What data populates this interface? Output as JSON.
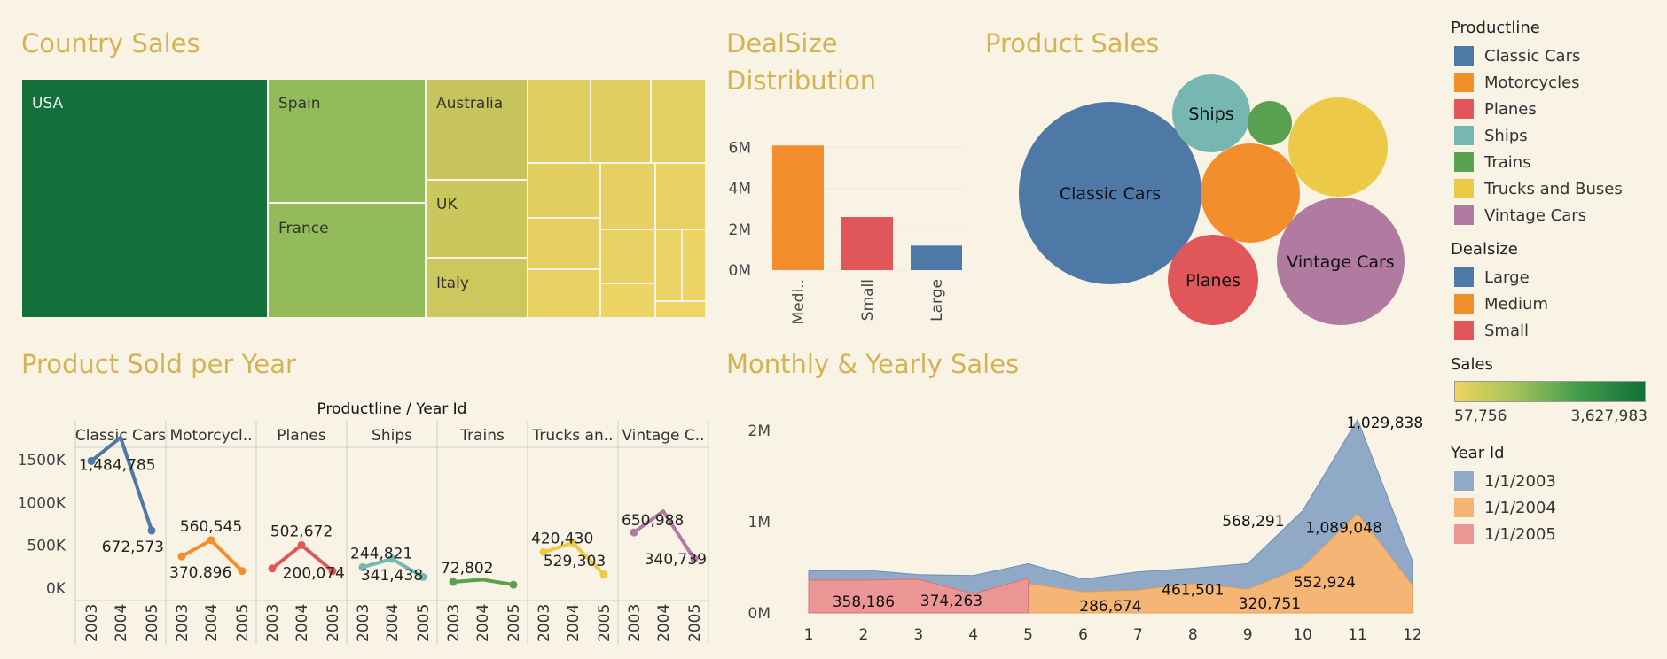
{
  "titles": {
    "country_sales": "Country Sales",
    "dealsize_line1": "DealSize",
    "dealsize_line2": "Distribution",
    "product_sales": "Product Sales",
    "product_sold_per_year": "Product Sold per Year",
    "monthly_yearly": "Monthly & Yearly Sales"
  },
  "legend": {
    "productline_title": "Productline",
    "productline_items": [
      {
        "label": "Classic Cars",
        "color": "#4e79a7"
      },
      {
        "label": "Motorcycles",
        "color": "#f28e2b"
      },
      {
        "label": "Planes",
        "color": "#e15759"
      },
      {
        "label": "Ships",
        "color": "#76b7b2"
      },
      {
        "label": "Trains",
        "color": "#59a14f"
      },
      {
        "label": "Trucks and Buses",
        "color": "#edc948"
      },
      {
        "label": "Vintage Cars",
        "color": "#b07aa1"
      }
    ],
    "dealsize_title": "Dealsize",
    "dealsize_items": [
      {
        "label": "Large",
        "color": "#4e79a7"
      },
      {
        "label": "Medium",
        "color": "#f28e2b"
      },
      {
        "label": "Small",
        "color": "#e15759"
      }
    ],
    "sales_title": "Sales",
    "sales_min": "57,756",
    "sales_max": "3,627,983",
    "year_title": "Year Id",
    "year_items": [
      {
        "label": "1/1/2003",
        "color": "#8fa9c7"
      },
      {
        "label": "1/1/2004",
        "color": "#f5b574"
      },
      {
        "label": "1/1/2005",
        "color": "#eb9595"
      }
    ]
  },
  "chart_data": [
    {
      "type": "treemap",
      "title": "Country Sales",
      "labels": [
        "USA",
        "Spain",
        "France",
        "Australia",
        "UK",
        "Italy"
      ],
      "color_measure": "Sales",
      "color_range": [
        57756,
        3627983
      ]
    },
    {
      "type": "bar",
      "title": "DealSize Distribution",
      "categories": [
        "Medi..",
        "Small",
        "Large"
      ],
      "values": [
        6.1,
        2.6,
        1.2
      ],
      "colors": [
        "#f28e2b",
        "#e15759",
        "#4e79a7"
      ],
      "yticks": [
        "0M",
        "2M",
        "4M",
        "6M"
      ],
      "ylim": [
        0,
        6.5
      ]
    },
    {
      "type": "bubble",
      "title": "Product Sales",
      "items": [
        {
          "label": "Classic Cars",
          "color": "#4e79a7"
        },
        {
          "label": "Ships",
          "color": "#76b7b2"
        },
        {
          "label": "",
          "color": "#59a14f"
        },
        {
          "label": "",
          "color": "#edc948"
        },
        {
          "label": "",
          "color": "#f28e2b"
        },
        {
          "label": "Vintage Cars",
          "color": "#b07aa1"
        },
        {
          "label": "Planes",
          "color": "#e15759"
        }
      ]
    },
    {
      "type": "line",
      "title": "Product Sold per Year",
      "header": "Productline  /  Year Id",
      "panels": [
        "Classic Cars",
        "Motorcycl..",
        "Planes",
        "Ships",
        "Trains",
        "Trucks an..",
        "Vintage C.."
      ],
      "years": [
        "2003",
        "2004",
        "2005"
      ],
      "yticks": [
        "0K",
        "500K",
        "1000K",
        "1500K"
      ],
      "ylim": [
        0,
        2000000
      ],
      "series": [
        {
          "name": "Classic Cars",
          "color": "#4e79a7",
          "values": [
            1484785,
            1760000,
            672573
          ]
        },
        {
          "name": "Motorcycles",
          "color": "#f28e2b",
          "values": [
            370896,
            560545,
            200000
          ]
        },
        {
          "name": "Planes",
          "color": "#e15759",
          "values": [
            230000,
            502672,
            200074
          ]
        },
        {
          "name": "Ships",
          "color": "#76b7b2",
          "values": [
            244821,
            341438,
            130000
          ]
        },
        {
          "name": "Trains",
          "color": "#59a14f",
          "values": [
            72802,
            100000,
            40000
          ]
        },
        {
          "name": "Trucks and Buses",
          "color": "#edc948",
          "values": [
            420430,
            529303,
            160000
          ]
        },
        {
          "name": "Vintage Cars",
          "color": "#b07aa1",
          "values": [
            650988,
            900000,
            340739
          ]
        }
      ],
      "labels": [
        [
          "1,484,785",
          "",
          "672,573"
        ],
        [
          "370,896",
          "560,545",
          ""
        ],
        [
          "",
          "502,672",
          "200,074"
        ],
        [
          "244,821",
          "341,438",
          ""
        ],
        [
          "72,802",
          "",
          ""
        ],
        [
          "420,430",
          "529,303",
          ""
        ],
        [
          "650,988",
          "",
          "340,739"
        ]
      ]
    },
    {
      "type": "area",
      "title": "Monthly & Yearly Sales",
      "x": [
        1,
        2,
        3,
        4,
        5,
        6,
        7,
        8,
        9,
        10,
        11,
        12
      ],
      "yticks": [
        "0M",
        "1M",
        "2M"
      ],
      "ylim": [
        0,
        2.2
      ],
      "series": [
        {
          "name": "1/1/2003",
          "color": "#8fa9c7",
          "values": [
            0.13,
            0.14,
            0.12,
            0.2,
            0.22,
            0.14,
            0.2,
            0.17,
            0.28,
            0.62,
            1.03,
            0.27
          ]
        },
        {
          "name": "1/1/2004",
          "color": "#f5b574",
          "values": [
            0.33,
            0.33,
            0.3,
            0.21,
            0.32,
            0.23,
            0.25,
            0.32,
            0.26,
            0.5,
            1.09,
            0.3
          ]
        },
        {
          "name": "1/1/2005",
          "color": "#eb9595",
          "values": [
            0.36,
            0.36,
            0.37,
            0.21,
            0.38
          ]
        }
      ],
      "labels": [
        {
          "text": "358,186",
          "x": 2.0,
          "y": 0.07
        },
        {
          "text": "374,263",
          "x": 3.6,
          "y": 0.08
        },
        {
          "text": "286,674",
          "x": 6.5,
          "y": 0.02
        },
        {
          "text": "461,501",
          "x": 8.0,
          "y": 0.2
        },
        {
          "text": "320,751",
          "x": 9.4,
          "y": 0.05
        },
        {
          "text": "552,924",
          "x": 10.4,
          "y": 0.28
        },
        {
          "text": "568,291",
          "x": 9.1,
          "y": 0.95
        },
        {
          "text": "1,089,048",
          "x": 10.75,
          "y": 0.88
        },
        {
          "text": "1,029,838",
          "x": 11.5,
          "y": 2.03
        }
      ]
    }
  ]
}
